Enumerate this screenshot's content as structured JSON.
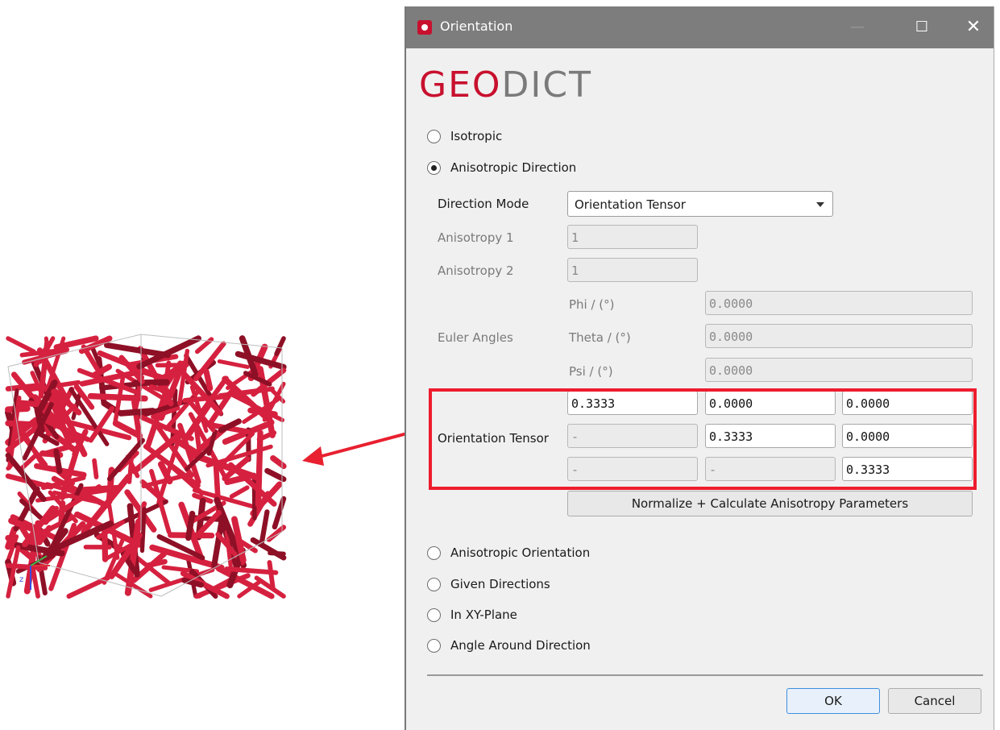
{
  "window": {
    "title": "Orientation",
    "minimize_glyph": "—",
    "maximize_glyph": "☐",
    "close_glyph": "✕"
  },
  "logo": {
    "part1": "GEO",
    "part2": "DICT"
  },
  "modes": {
    "isotropic": "Isotropic",
    "anisotropic_direction": "Anisotropic Direction",
    "anisotropic_orientation": "Anisotropic Orientation",
    "given_directions": "Given Directions",
    "in_xy_plane": "In XY-Plane",
    "angle_around_direction": "Angle Around Direction",
    "selected": "anisotropic_direction"
  },
  "direction_mode": {
    "label": "Direction Mode",
    "value": "Orientation Tensor"
  },
  "anisotropy": {
    "a1_label": "Anisotropy 1",
    "a1_value": "1",
    "a2_label": "Anisotropy 2",
    "a2_value": "1"
  },
  "euler": {
    "label": "Euler Angles",
    "phi_label": "Phi / (°)",
    "phi_value": "0.0000",
    "theta_label": "Theta / (°)",
    "theta_value": "0.0000",
    "psi_label": "Psi / (°)",
    "psi_value": "0.0000"
  },
  "tensor": {
    "label": "Orientation Tensor",
    "rows": [
      [
        "0.3333",
        "0.0000",
        "0.0000"
      ],
      [
        "-",
        "0.3333",
        "0.0000"
      ],
      [
        "-",
        "-",
        "0.3333"
      ]
    ]
  },
  "normalize_button": "Normalize + Calculate Anisotropy Parameters",
  "footer": {
    "ok": "OK",
    "cancel": "Cancel"
  },
  "colors": {
    "accent_red": "#c8102e",
    "highlight_red": "#ee1c2e",
    "fiber_red": "#d5213f",
    "arrow_red": "#e8202f"
  },
  "icons": {
    "app": "geodict-app-icon",
    "dropdown": "chevron-down-icon",
    "axes": "xyz-axes-icon"
  }
}
